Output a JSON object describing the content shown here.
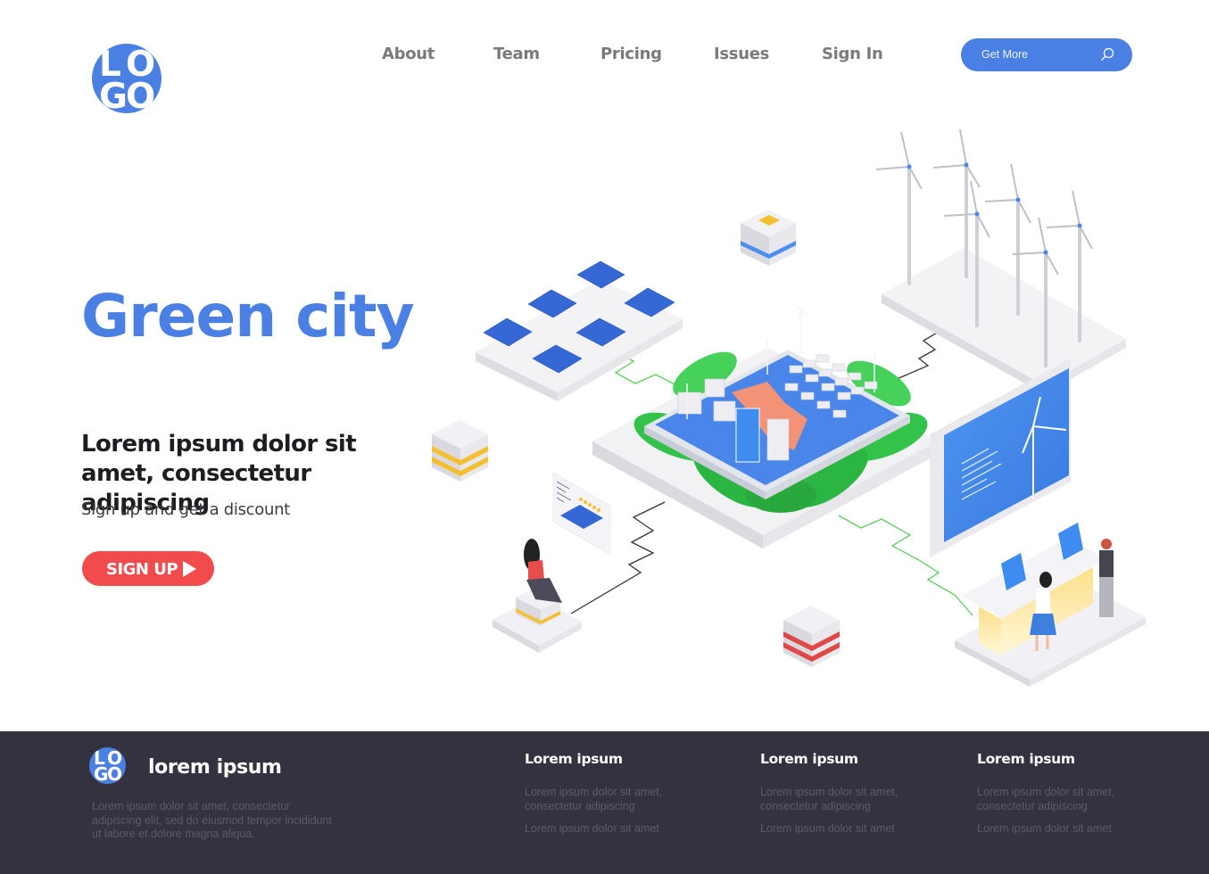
{
  "header": {
    "logo_letters": [
      "L",
      "O",
      "G",
      "O"
    ],
    "nav": [
      {
        "label": "About"
      },
      {
        "label": "Team"
      },
      {
        "label": "Pricing"
      },
      {
        "label": "Issues"
      },
      {
        "label": "Sign In"
      }
    ],
    "search": {
      "label": "Get More",
      "icon": "search-icon"
    }
  },
  "hero": {
    "title": "Green city",
    "subtitle": "Lorem ipsum dolor sit amet, consectetur adipiscing",
    "tagline": "Sign up and get a discount",
    "cta_label": "SIGN UP",
    "cta_icon": "play-icon"
  },
  "illustration": {
    "description": "Isometric green city: tablet with city map on green leaves, solar panel farm, wind turbine farm, monitoring screen with wind turbine, people at laptops, woman seated viewing solar panel rating card, stacked server blocks",
    "rating_stars": 5
  },
  "colors": {
    "brand_blue": "#4a80e4",
    "cta_red": "#f24b4e",
    "footer_bg": "#35323f",
    "heading_dark": "#1d1d22",
    "nav_gray": "#7a7a7a"
  },
  "footer": {
    "logo_letters": [
      "L",
      "O",
      "G",
      "O"
    ],
    "brand": "lorem ipsum",
    "description": "Lorem ipsum dolor sit amet, consectetur adipiscing elit, sed do eiusmod tempor incididunt ut labore et dolore magna aliqua.",
    "columns": [
      {
        "title": "Lorem ipsum",
        "link1": "Lorem ipsum dolor sit amet, consectetur adipiscing",
        "link2": "Lorem ipsum dolor sit amet"
      },
      {
        "title": "Lorem ipsum",
        "link1": "Lorem ipsum dolor sit amet, consectetur adipiscing",
        "link2": "Lorem ipsum dolor sit amet"
      },
      {
        "title": "Lorem ipsum",
        "link1": "Lorem ipsum dolor sit amet, consectetur adipiscing",
        "link2": "Lorem ipsum dolor sit amet"
      }
    ]
  }
}
